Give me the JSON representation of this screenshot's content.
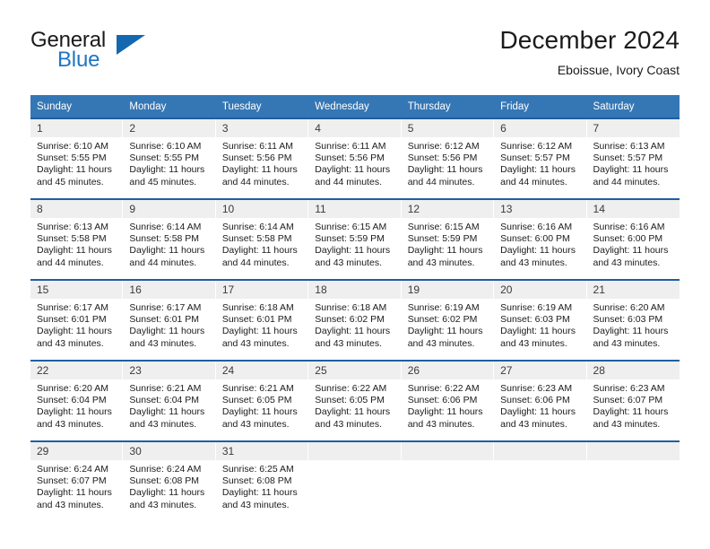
{
  "brand": {
    "name_top": "General",
    "name_bottom": "Blue",
    "triangle_color": "#1567b0",
    "blue_color": "#1f76c2"
  },
  "header": {
    "title": "December 2024",
    "subtitle": "Eboissue, Ivory Coast"
  },
  "theme": {
    "header_bg": "#3577b5",
    "row_divider": "#1f5fa0",
    "daynum_bg": "#efefef",
    "text": "#1b1b1b"
  },
  "weekdays": [
    "Sunday",
    "Monday",
    "Tuesday",
    "Wednesday",
    "Thursday",
    "Friday",
    "Saturday"
  ],
  "days": [
    {
      "n": "1",
      "sunrise": "Sunrise: 6:10 AM",
      "sunset": "Sunset: 5:55 PM",
      "daylight1": "Daylight: 11 hours",
      "daylight2": "and 45 minutes."
    },
    {
      "n": "2",
      "sunrise": "Sunrise: 6:10 AM",
      "sunset": "Sunset: 5:55 PM",
      "daylight1": "Daylight: 11 hours",
      "daylight2": "and 45 minutes."
    },
    {
      "n": "3",
      "sunrise": "Sunrise: 6:11 AM",
      "sunset": "Sunset: 5:56 PM",
      "daylight1": "Daylight: 11 hours",
      "daylight2": "and 44 minutes."
    },
    {
      "n": "4",
      "sunrise": "Sunrise: 6:11 AM",
      "sunset": "Sunset: 5:56 PM",
      "daylight1": "Daylight: 11 hours",
      "daylight2": "and 44 minutes."
    },
    {
      "n": "5",
      "sunrise": "Sunrise: 6:12 AM",
      "sunset": "Sunset: 5:56 PM",
      "daylight1": "Daylight: 11 hours",
      "daylight2": "and 44 minutes."
    },
    {
      "n": "6",
      "sunrise": "Sunrise: 6:12 AM",
      "sunset": "Sunset: 5:57 PM",
      "daylight1": "Daylight: 11 hours",
      "daylight2": "and 44 minutes."
    },
    {
      "n": "7",
      "sunrise": "Sunrise: 6:13 AM",
      "sunset": "Sunset: 5:57 PM",
      "daylight1": "Daylight: 11 hours",
      "daylight2": "and 44 minutes."
    },
    {
      "n": "8",
      "sunrise": "Sunrise: 6:13 AM",
      "sunset": "Sunset: 5:58 PM",
      "daylight1": "Daylight: 11 hours",
      "daylight2": "and 44 minutes."
    },
    {
      "n": "9",
      "sunrise": "Sunrise: 6:14 AM",
      "sunset": "Sunset: 5:58 PM",
      "daylight1": "Daylight: 11 hours",
      "daylight2": "and 44 minutes."
    },
    {
      "n": "10",
      "sunrise": "Sunrise: 6:14 AM",
      "sunset": "Sunset: 5:58 PM",
      "daylight1": "Daylight: 11 hours",
      "daylight2": "and 44 minutes."
    },
    {
      "n": "11",
      "sunrise": "Sunrise: 6:15 AM",
      "sunset": "Sunset: 5:59 PM",
      "daylight1": "Daylight: 11 hours",
      "daylight2": "and 43 minutes."
    },
    {
      "n": "12",
      "sunrise": "Sunrise: 6:15 AM",
      "sunset": "Sunset: 5:59 PM",
      "daylight1": "Daylight: 11 hours",
      "daylight2": "and 43 minutes."
    },
    {
      "n": "13",
      "sunrise": "Sunrise: 6:16 AM",
      "sunset": "Sunset: 6:00 PM",
      "daylight1": "Daylight: 11 hours",
      "daylight2": "and 43 minutes."
    },
    {
      "n": "14",
      "sunrise": "Sunrise: 6:16 AM",
      "sunset": "Sunset: 6:00 PM",
      "daylight1": "Daylight: 11 hours",
      "daylight2": "and 43 minutes."
    },
    {
      "n": "15",
      "sunrise": "Sunrise: 6:17 AM",
      "sunset": "Sunset: 6:01 PM",
      "daylight1": "Daylight: 11 hours",
      "daylight2": "and 43 minutes."
    },
    {
      "n": "16",
      "sunrise": "Sunrise: 6:17 AM",
      "sunset": "Sunset: 6:01 PM",
      "daylight1": "Daylight: 11 hours",
      "daylight2": "and 43 minutes."
    },
    {
      "n": "17",
      "sunrise": "Sunrise: 6:18 AM",
      "sunset": "Sunset: 6:01 PM",
      "daylight1": "Daylight: 11 hours",
      "daylight2": "and 43 minutes."
    },
    {
      "n": "18",
      "sunrise": "Sunrise: 6:18 AM",
      "sunset": "Sunset: 6:02 PM",
      "daylight1": "Daylight: 11 hours",
      "daylight2": "and 43 minutes."
    },
    {
      "n": "19",
      "sunrise": "Sunrise: 6:19 AM",
      "sunset": "Sunset: 6:02 PM",
      "daylight1": "Daylight: 11 hours",
      "daylight2": "and 43 minutes."
    },
    {
      "n": "20",
      "sunrise": "Sunrise: 6:19 AM",
      "sunset": "Sunset: 6:03 PM",
      "daylight1": "Daylight: 11 hours",
      "daylight2": "and 43 minutes."
    },
    {
      "n": "21",
      "sunrise": "Sunrise: 6:20 AM",
      "sunset": "Sunset: 6:03 PM",
      "daylight1": "Daylight: 11 hours",
      "daylight2": "and 43 minutes."
    },
    {
      "n": "22",
      "sunrise": "Sunrise: 6:20 AM",
      "sunset": "Sunset: 6:04 PM",
      "daylight1": "Daylight: 11 hours",
      "daylight2": "and 43 minutes."
    },
    {
      "n": "23",
      "sunrise": "Sunrise: 6:21 AM",
      "sunset": "Sunset: 6:04 PM",
      "daylight1": "Daylight: 11 hours",
      "daylight2": "and 43 minutes."
    },
    {
      "n": "24",
      "sunrise": "Sunrise: 6:21 AM",
      "sunset": "Sunset: 6:05 PM",
      "daylight1": "Daylight: 11 hours",
      "daylight2": "and 43 minutes."
    },
    {
      "n": "25",
      "sunrise": "Sunrise: 6:22 AM",
      "sunset": "Sunset: 6:05 PM",
      "daylight1": "Daylight: 11 hours",
      "daylight2": "and 43 minutes."
    },
    {
      "n": "26",
      "sunrise": "Sunrise: 6:22 AM",
      "sunset": "Sunset: 6:06 PM",
      "daylight1": "Daylight: 11 hours",
      "daylight2": "and 43 minutes."
    },
    {
      "n": "27",
      "sunrise": "Sunrise: 6:23 AM",
      "sunset": "Sunset: 6:06 PM",
      "daylight1": "Daylight: 11 hours",
      "daylight2": "and 43 minutes."
    },
    {
      "n": "28",
      "sunrise": "Sunrise: 6:23 AM",
      "sunset": "Sunset: 6:07 PM",
      "daylight1": "Daylight: 11 hours",
      "daylight2": "and 43 minutes."
    },
    {
      "n": "29",
      "sunrise": "Sunrise: 6:24 AM",
      "sunset": "Sunset: 6:07 PM",
      "daylight1": "Daylight: 11 hours",
      "daylight2": "and 43 minutes."
    },
    {
      "n": "30",
      "sunrise": "Sunrise: 6:24 AM",
      "sunset": "Sunset: 6:08 PM",
      "daylight1": "Daylight: 11 hours",
      "daylight2": "and 43 minutes."
    },
    {
      "n": "31",
      "sunrise": "Sunrise: 6:25 AM",
      "sunset": "Sunset: 6:08 PM",
      "daylight1": "Daylight: 11 hours",
      "daylight2": "and 43 minutes."
    }
  ],
  "grid": {
    "leading_blanks": 0,
    "weeks": 5
  }
}
